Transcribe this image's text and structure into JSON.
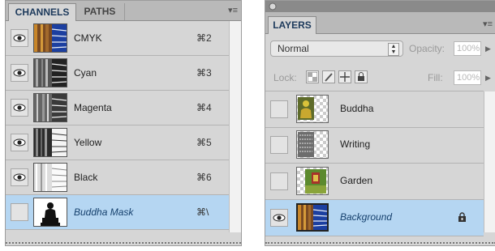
{
  "channels_panel": {
    "tabs": [
      {
        "label": "CHANNELS"
      },
      {
        "label": "PATHS"
      }
    ],
    "menu_icon": "panel-menu-icon",
    "channels": [
      {
        "name": "CMYK",
        "shortcut": "⌘2",
        "visible": true
      },
      {
        "name": "Cyan",
        "shortcut": "⌘3",
        "visible": true
      },
      {
        "name": "Magenta",
        "shortcut": "⌘4",
        "visible": true
      },
      {
        "name": "Yellow",
        "shortcut": "⌘5",
        "visible": true
      },
      {
        "name": "Black",
        "shortcut": "⌘6",
        "visible": true
      },
      {
        "name": "Buddha Mask",
        "shortcut": "⌘\\",
        "visible": false,
        "selected": true
      }
    ]
  },
  "layers_panel": {
    "tabs": [
      {
        "label": "LAYERS"
      }
    ],
    "blend_mode": "Normal",
    "opacity_label": "Opacity:",
    "opacity_value": "100%",
    "lock_label": "Lock:",
    "fill_label": "Fill:",
    "fill_value": "100%",
    "layers": [
      {
        "name": "Buddha",
        "visible": false
      },
      {
        "name": "Writing",
        "visible": false
      },
      {
        "name": "Garden",
        "visible": false
      },
      {
        "name": "Background",
        "visible": true,
        "selected": true,
        "locked": true
      }
    ]
  },
  "colors": {
    "selection": "#b5d6f2",
    "panel": "#d6d6d6",
    "tabbar": "#b9b9b9"
  }
}
